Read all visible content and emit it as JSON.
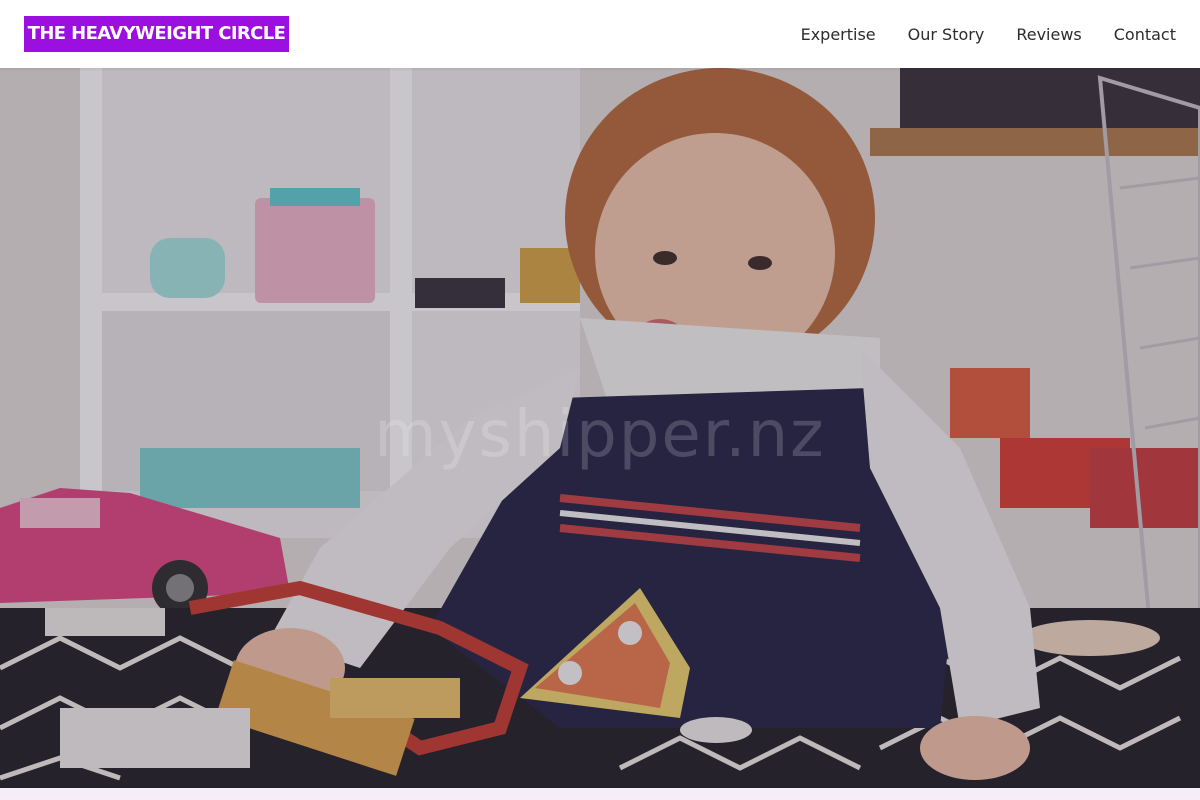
{
  "header": {
    "logo_text": "THE HEAVYWEIGHT CIRCLE",
    "logo_bg": "#9b10e0",
    "nav": [
      {
        "label": "Expertise"
      },
      {
        "label": "Our Story"
      },
      {
        "label": "Reviews"
      },
      {
        "label": "Contact"
      }
    ]
  },
  "hero": {
    "watermark": "myshipper.nz",
    "image_subject": "toddler playing with wooden toy pizza on patterned rug"
  }
}
